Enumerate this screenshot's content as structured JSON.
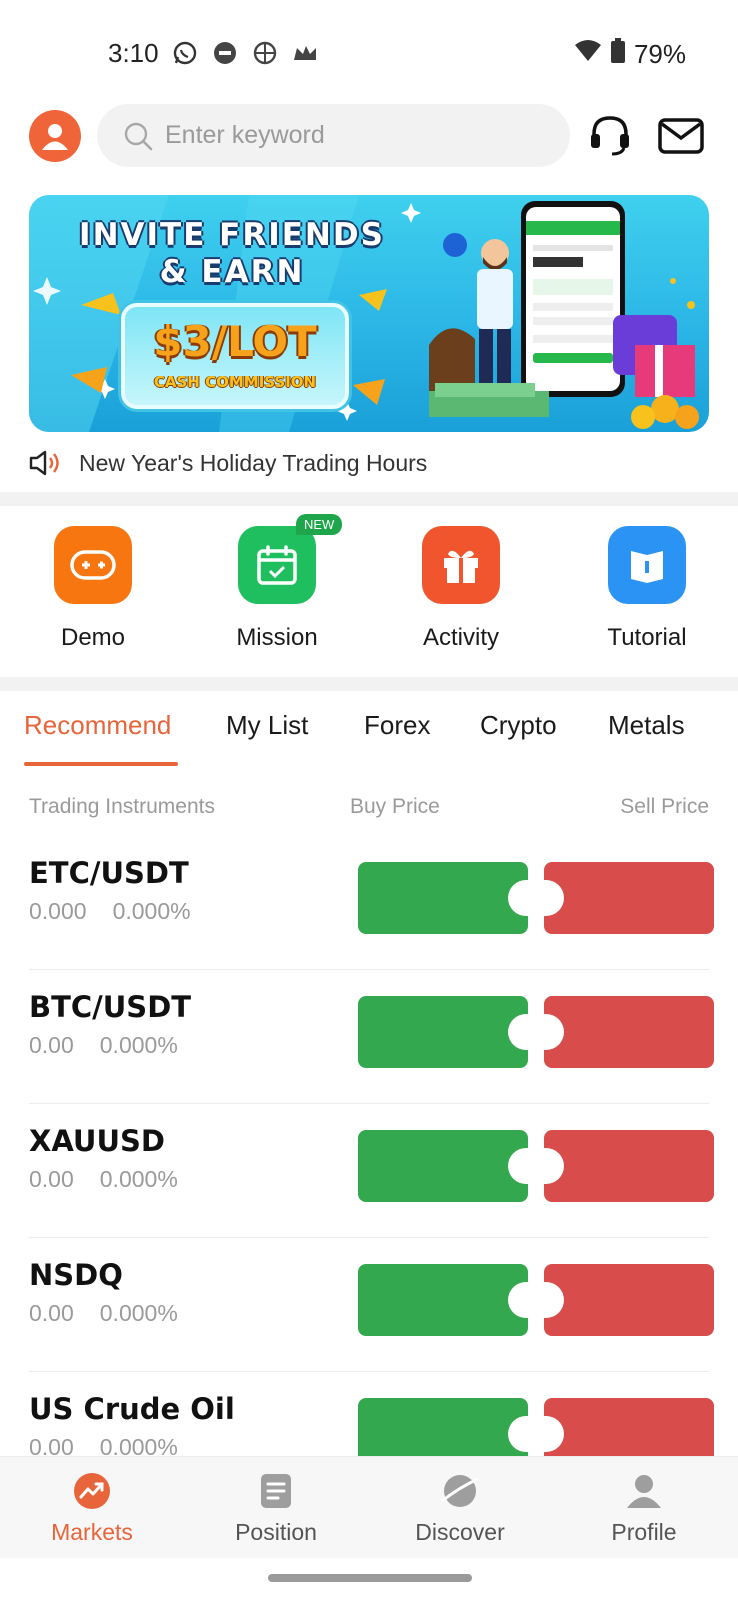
{
  "status_bar": {
    "time": "3:10",
    "battery": "79%"
  },
  "header": {
    "search_placeholder": "Enter keyword"
  },
  "banner": {
    "title": "INVITE FRIENDS & EARN",
    "amount": "$3/LOT",
    "subtitle": "CASH COMMISSION"
  },
  "notice": {
    "text": "New Year's Holiday Trading Hours"
  },
  "quick_actions": [
    {
      "label": "Demo",
      "color": "#f7760f"
    },
    {
      "label": "Mission",
      "color": "#1fbe5e",
      "badge": "NEW"
    },
    {
      "label": "Activity",
      "color": "#f0552d"
    },
    {
      "label": "Tutorial",
      "color": "#2a93f3"
    }
  ],
  "tabs": [
    "Recommend",
    "My List",
    "Forex",
    "Crypto",
    "Metals"
  ],
  "active_tab": "Recommend",
  "columns": {
    "instrument": "Trading Instruments",
    "buy": "Buy Price",
    "sell": "Sell Price"
  },
  "instruments": [
    {
      "symbol": "ETC/USDT",
      "price": "0.000",
      "change": "0.000%"
    },
    {
      "symbol": "BTC/USDT",
      "price": "0.00",
      "change": "0.000%"
    },
    {
      "symbol": "XAUUSD",
      "price": "0.00",
      "change": "0.000%"
    },
    {
      "symbol": "NSDQ",
      "price": "0.00",
      "change": "0.000%"
    },
    {
      "symbol": "US Crude Oil",
      "price": "0.00",
      "change": "0.000%"
    }
  ],
  "bottom_nav": [
    {
      "label": "Markets",
      "active": true
    },
    {
      "label": "Position",
      "active": false
    },
    {
      "label": "Discover",
      "active": false
    },
    {
      "label": "Profile",
      "active": false
    }
  ],
  "colors": {
    "accent": "#e8643a",
    "buy": "#34a84e",
    "sell": "#d94c4c"
  }
}
